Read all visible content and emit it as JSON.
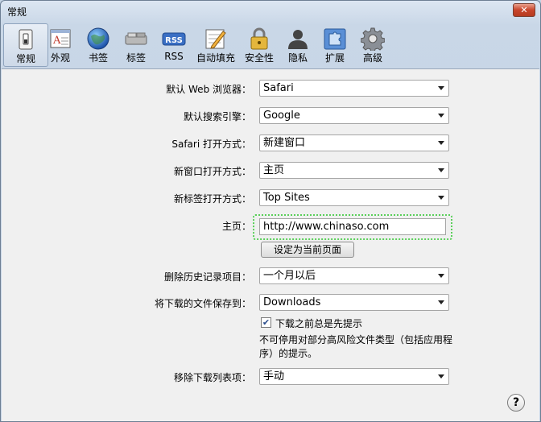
{
  "window": {
    "title": "常规"
  },
  "toolbar": {
    "items": [
      {
        "label": "常规",
        "icon": "general-switch-icon"
      },
      {
        "label": "外观",
        "icon": "appearance-icon"
      },
      {
        "label": "书签",
        "icon": "globe-icon"
      },
      {
        "label": "标签",
        "icon": "tabs-icon"
      },
      {
        "label": "RSS",
        "icon": "rss-icon"
      },
      {
        "label": "自动填充",
        "icon": "autofill-pencil-icon"
      },
      {
        "label": "安全性",
        "icon": "lock-icon"
      },
      {
        "label": "隐私",
        "icon": "person-icon"
      },
      {
        "label": "扩展",
        "icon": "puzzle-icon"
      },
      {
        "label": "高级",
        "icon": "gear-icon"
      }
    ],
    "rss_text": "RSS"
  },
  "settings": {
    "default_browser": {
      "label": "默认 Web 浏览器：",
      "value": "Safari"
    },
    "default_search": {
      "label": "默认搜索引擎：",
      "value": "Google"
    },
    "safari_open": {
      "label": "Safari 打开方式：",
      "value": "新建窗口"
    },
    "new_window": {
      "label": "新窗口打开方式：",
      "value": "主页"
    },
    "new_tab": {
      "label": "新标签打开方式：",
      "value": "Top Sites"
    },
    "homepage": {
      "label": "主页：",
      "value": "http://www.chinaso.com"
    },
    "set_current_button": "设定为当前页面",
    "remove_history": {
      "label": "删除历史记录项目：",
      "value": "一个月以后"
    },
    "save_downloads": {
      "label": "将下载的文件保存到：",
      "value": "Downloads"
    },
    "ask_before_download": {
      "label": "下载之前总是先提示",
      "checked": true
    },
    "note": "不可停用对部分高风险文件类型（包括应用程序）的提示。",
    "remove_download_list": {
      "label": "移除下载列表项：",
      "value": "手动"
    }
  },
  "help": "?"
}
